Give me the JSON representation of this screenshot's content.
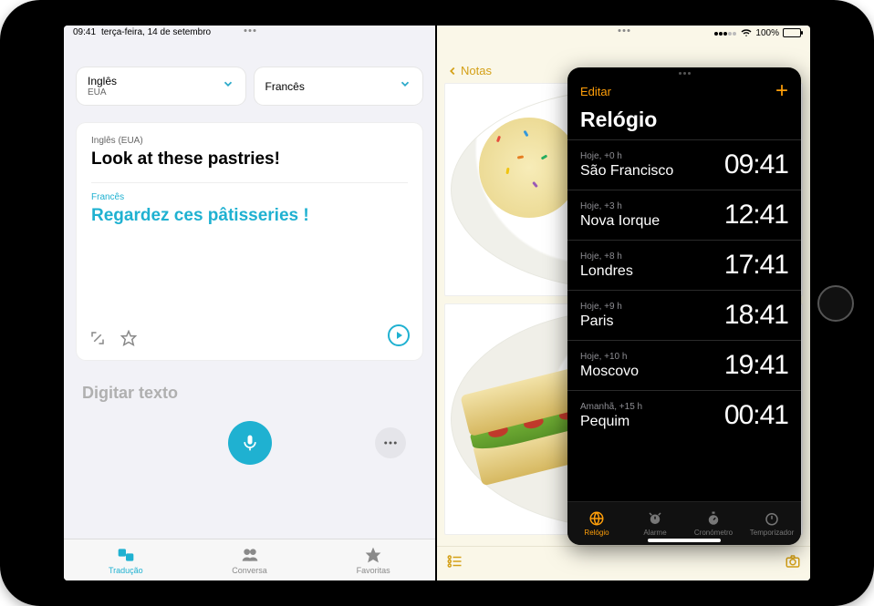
{
  "status": {
    "time": "09:41",
    "date": "terça-feira, 14 de setembro",
    "battery_pct": "100%"
  },
  "translate": {
    "source_lang_name": "Inglês",
    "source_lang_region": "EUA",
    "target_lang_name": "Francês",
    "source_lang_full": "Inglês (EUA)",
    "source_text": "Look at these pastries!",
    "target_lang_label": "Francês",
    "target_text": "Regardez ces pâtisseries !",
    "input_placeholder": "Digitar texto",
    "tabs": {
      "translate": "Tradução",
      "conversation": "Conversa",
      "favorites": "Favoritas"
    }
  },
  "notes": {
    "back_label": "Notas"
  },
  "clock": {
    "edit": "Editar",
    "title": "Relógio",
    "cities": [
      {
        "offset": "Hoje, +0 h",
        "name": "São Francisco",
        "time": "09:41"
      },
      {
        "offset": "Hoje, +3 h",
        "name": "Nova Iorque",
        "time": "12:41"
      },
      {
        "offset": "Hoje, +8 h",
        "name": "Londres",
        "time": "17:41"
      },
      {
        "offset": "Hoje, +9 h",
        "name": "Paris",
        "time": "18:41"
      },
      {
        "offset": "Hoje, +10 h",
        "name": "Moscovo",
        "time": "19:41"
      },
      {
        "offset": "Amanhã, +15 h",
        "name": "Pequim",
        "time": "00:41"
      }
    ],
    "tabs": {
      "world": "Relógio",
      "alarm": "Alarme",
      "stopwatch": "Cronómetro",
      "timer": "Temporizador"
    }
  }
}
